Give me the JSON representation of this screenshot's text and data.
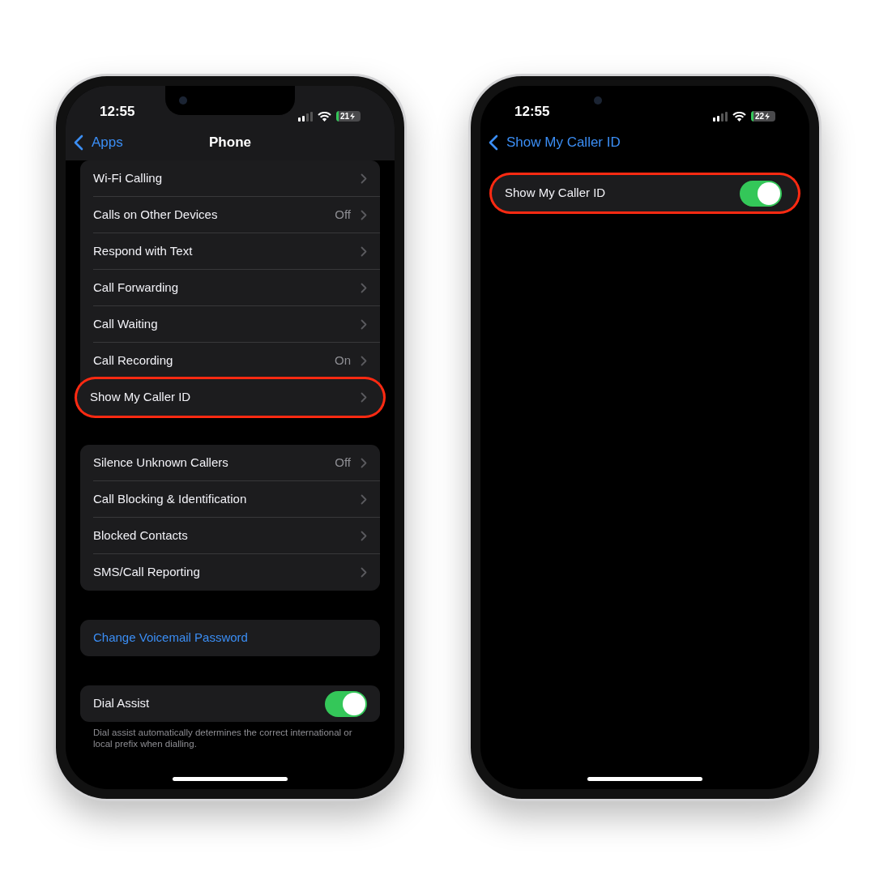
{
  "phones": [
    {
      "status_bar": {
        "time": "12:55",
        "battery": "21"
      },
      "nav": {
        "back": "Apps",
        "title": "Phone"
      },
      "groups": [
        {
          "rows": [
            {
              "kind": "link",
              "label": "Wi-Fi Calling",
              "highlighted": false
            },
            {
              "kind": "link",
              "label": "Calls on Other Devices",
              "value": "Off",
              "highlighted": false
            },
            {
              "kind": "link",
              "label": "Respond with Text",
              "highlighted": false
            },
            {
              "kind": "link",
              "label": "Call Forwarding",
              "highlighted": false
            },
            {
              "kind": "link",
              "label": "Call Waiting",
              "highlighted": false
            },
            {
              "kind": "link",
              "label": "Call Recording",
              "value": "On",
              "highlighted": false
            },
            {
              "kind": "link",
              "label": "Show My Caller ID",
              "highlighted": true
            }
          ]
        },
        {
          "rows": [
            {
              "kind": "link",
              "label": "Silence Unknown Callers",
              "value": "Off",
              "highlighted": false
            },
            {
              "kind": "link",
              "label": "Call Blocking & Identification",
              "highlighted": false
            },
            {
              "kind": "link",
              "label": "Blocked Contacts",
              "highlighted": false
            },
            {
              "kind": "link",
              "label": "SMS/Call Reporting",
              "highlighted": false
            }
          ]
        },
        {
          "rows": [
            {
              "kind": "action",
              "label": "Change Voicemail Password",
              "highlighted": false
            }
          ]
        },
        {
          "rows": [
            {
              "kind": "toggle",
              "label": "Dial Assist",
              "on": true,
              "highlighted": false
            }
          ],
          "footer": "Dial assist automatically determines the correct international or local prefix when dialling."
        }
      ]
    },
    {
      "status_bar": {
        "time": "12:55",
        "battery": "22"
      },
      "nav": {
        "back": "Show My Caller ID"
      },
      "groups": [
        {
          "rows": [
            {
              "kind": "toggle",
              "label": "Show My Caller ID",
              "on": true,
              "highlighted": true
            }
          ]
        }
      ]
    }
  ]
}
